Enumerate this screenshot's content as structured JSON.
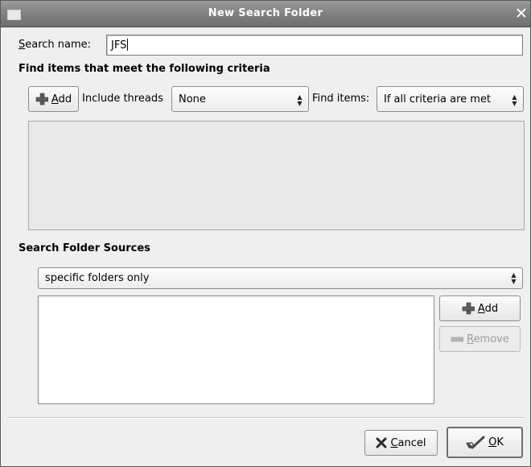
{
  "window": {
    "title": "New Search Folder"
  },
  "search_name": {
    "label_prefix": "S",
    "label_rest": "earch name:",
    "value": "JFS"
  },
  "criteria": {
    "heading": "Find items that meet the following criteria",
    "add_label_u": "A",
    "add_label_rest": "dd",
    "include_threads_label": "Include threads",
    "include_threads_value": "None",
    "find_items_label": "Find items:",
    "find_items_value": "If all criteria are met"
  },
  "sources": {
    "heading": "Search Folder Sources",
    "scope_value": "specific folders only",
    "add_label_u": "A",
    "add_label_rest": "dd",
    "remove_label_u": "R",
    "remove_label_rest": "emove"
  },
  "footer": {
    "cancel_label_u": "C",
    "cancel_label_rest": "ancel",
    "ok_label_u": "O",
    "ok_label_rest": "K"
  },
  "icons": {
    "window": "window-icon",
    "close": "close-icon",
    "add": "plus-icon",
    "remove": "minus-icon",
    "cancel": "x-icon",
    "ok": "checkmark-icon",
    "combo": "updown-arrow-icon"
  }
}
